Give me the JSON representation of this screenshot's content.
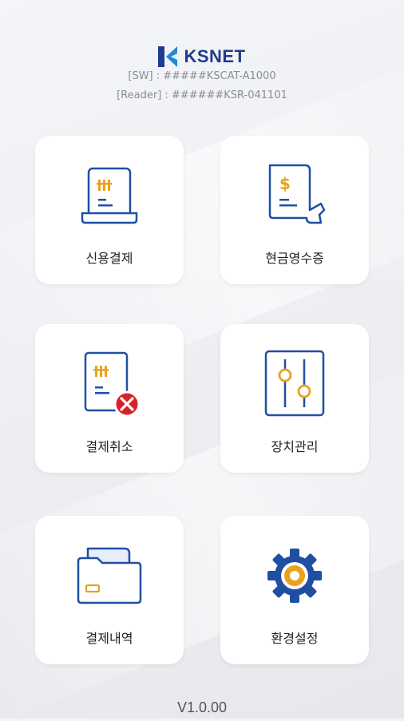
{
  "header": {
    "brand": "KSNET",
    "sw_line": "[SW] : #####KSCAT-A1000",
    "reader_line": "[Reader] : ######KSR-041101"
  },
  "menu": [
    {
      "label": "신용결제",
      "icon": "credit-receipt-icon"
    },
    {
      "label": "현금영수증",
      "icon": "cash-receipt-icon"
    },
    {
      "label": "결제취소",
      "icon": "cancel-receipt-icon"
    },
    {
      "label": "장치관리",
      "icon": "sliders-icon"
    },
    {
      "label": "결제내역",
      "icon": "folder-icon"
    },
    {
      "label": "환경설정",
      "icon": "gear-icon"
    }
  ],
  "footer": {
    "version": "V1.0.00"
  },
  "colors": {
    "primary": "#1f4fa3",
    "accent": "#e8a21d",
    "danger": "#d8222b"
  }
}
